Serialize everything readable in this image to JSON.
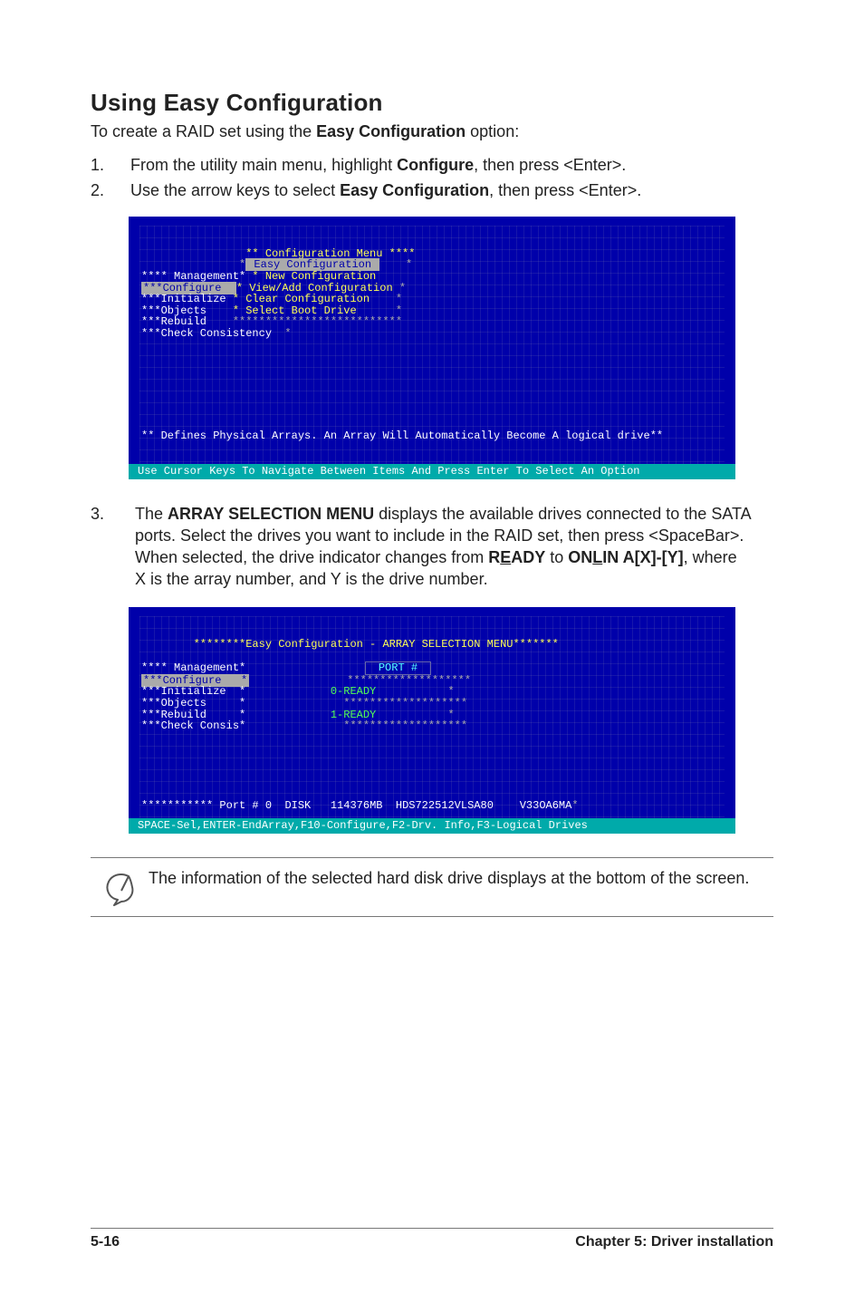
{
  "heading": "Using Easy Configuration",
  "intro_prefix": "To create a RAID set using the ",
  "intro_bold": "Easy Configuration",
  "intro_suffix": " option:",
  "steps": [
    {
      "num": "1.",
      "pre": "From the utility main menu, highlight ",
      "b1": "Configure",
      "mid": ", then press <Enter>."
    },
    {
      "num": "2.",
      "pre": "Use the arrow keys to select ",
      "b1": "Easy Configuration",
      "mid": ", then press <Enter>."
    }
  ],
  "term1": {
    "cfg_menu_label": "** Configuration Menu ****",
    "easy_sel": " Easy Configuration ",
    "management": "**** Management*",
    "rows_left": [
      "***Configure  ",
      "***Initialize ",
      "***Objects    ",
      "***Rebuild    "
    ],
    "rows_right": [
      "* New Configuration",
      "* View/Add Configuration",
      "* Clear Configuration",
      "* Select Boot Drive"
    ],
    "check": "***Check Consistency",
    "defines": "** Defines Physical Arrays. An Array Will Automatically Become A logical drive**",
    "bottom": "Use Cursor Keys To Navigate Between Items And Press Enter To Select An Option"
  },
  "step3": {
    "num": "3.",
    "t1": "The ",
    "b1": "ARRAY SELECTION MENU",
    "t2": " displays the available drives connected to the SATA ports. Select the drives you want to include in the RAID set, then press <SpaceBar>. When selected, the drive indicator changes from ",
    "b2_pre": "R",
    "b2_u": "E",
    "b2_post": "ADY",
    "t3": " to ",
    "b3_pre": "ON",
    "b3_u": "L",
    "b3_post": "IN A[X]-[Y]",
    "t4": ", where X is the array number, and Y is the drive number."
  },
  "term2": {
    "title": "********Easy Configuration - ARRAY SELECTION MENU*******",
    "left_rows": [
      "**** Management*",
      "***Configure   *",
      "***Initialize  *",
      "***Objects     *",
      "***Rebuild     *",
      "***Check Consis*"
    ],
    "port_label": "PORT #",
    "ready0": "0-READY",
    "ready1": "1-READY",
    "drive_row_label": "* Port # 0",
    "drive_disk": "DISK",
    "drive_size": "114376MB",
    "drive_model": "HDS722512VLSA80",
    "drive_fw": "V33OA6MA",
    "bottom": "SPACE-Sel,ENTER-EndArray,F10-Configure,F2-Drv. Info,F3-Logical Drives"
  },
  "note": "The information of the selected hard disk drive displays at the bottom of the screen.",
  "footer_left": "5-16",
  "footer_right": "Chapter 5: Driver installation"
}
